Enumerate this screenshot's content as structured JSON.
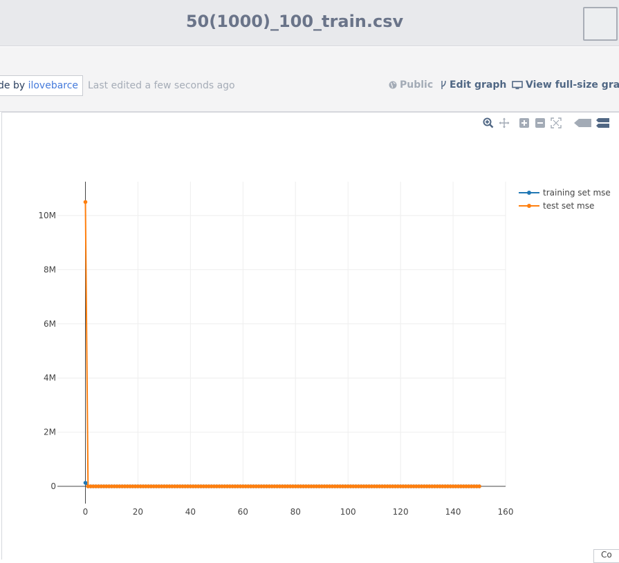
{
  "header": {
    "title": "50(1000)_100_train.csv"
  },
  "infobar": {
    "made_by_prefix": "de by ",
    "made_by_user": "ilovebarce",
    "last_edited": "Last edited a few seconds ago",
    "public_label": "Public",
    "edit_graph_label": "Edit graph",
    "view_full_label": "View full-size graph"
  },
  "modebar": {
    "icons": [
      "zoom-icon",
      "pan-icon",
      "zoom-in-icon",
      "zoom-out-icon",
      "autoscale-icon",
      "hover-closest-icon",
      "hover-compare-icon"
    ]
  },
  "corner_tab": {
    "label": "Co"
  },
  "colors": {
    "training": "#1f77b4",
    "test": "#ff7f0e",
    "grid": "#eeeeee",
    "axis_text": "#444444"
  },
  "chart_data": {
    "type": "line",
    "title": "",
    "xlabel": "",
    "ylabel": "",
    "xlim": [
      0,
      160
    ],
    "ylim": [
      -300000,
      11300000
    ],
    "x_ticks": [
      "0",
      "20",
      "40",
      "60",
      "80",
      "100",
      "120",
      "140",
      "160"
    ],
    "y_ticks": [
      "0",
      "2M",
      "4M",
      "6M",
      "8M",
      "10M"
    ],
    "grid": true,
    "legend_position": "top-right",
    "series": [
      {
        "name": "training set mse",
        "first_value": 130000,
        "rest_value": 0,
        "x_start": 0,
        "x_end": 150
      },
      {
        "name": "test set mse",
        "first_value": 10500000,
        "rest_value": 0,
        "x_start": 0,
        "x_end": 150
      }
    ]
  }
}
